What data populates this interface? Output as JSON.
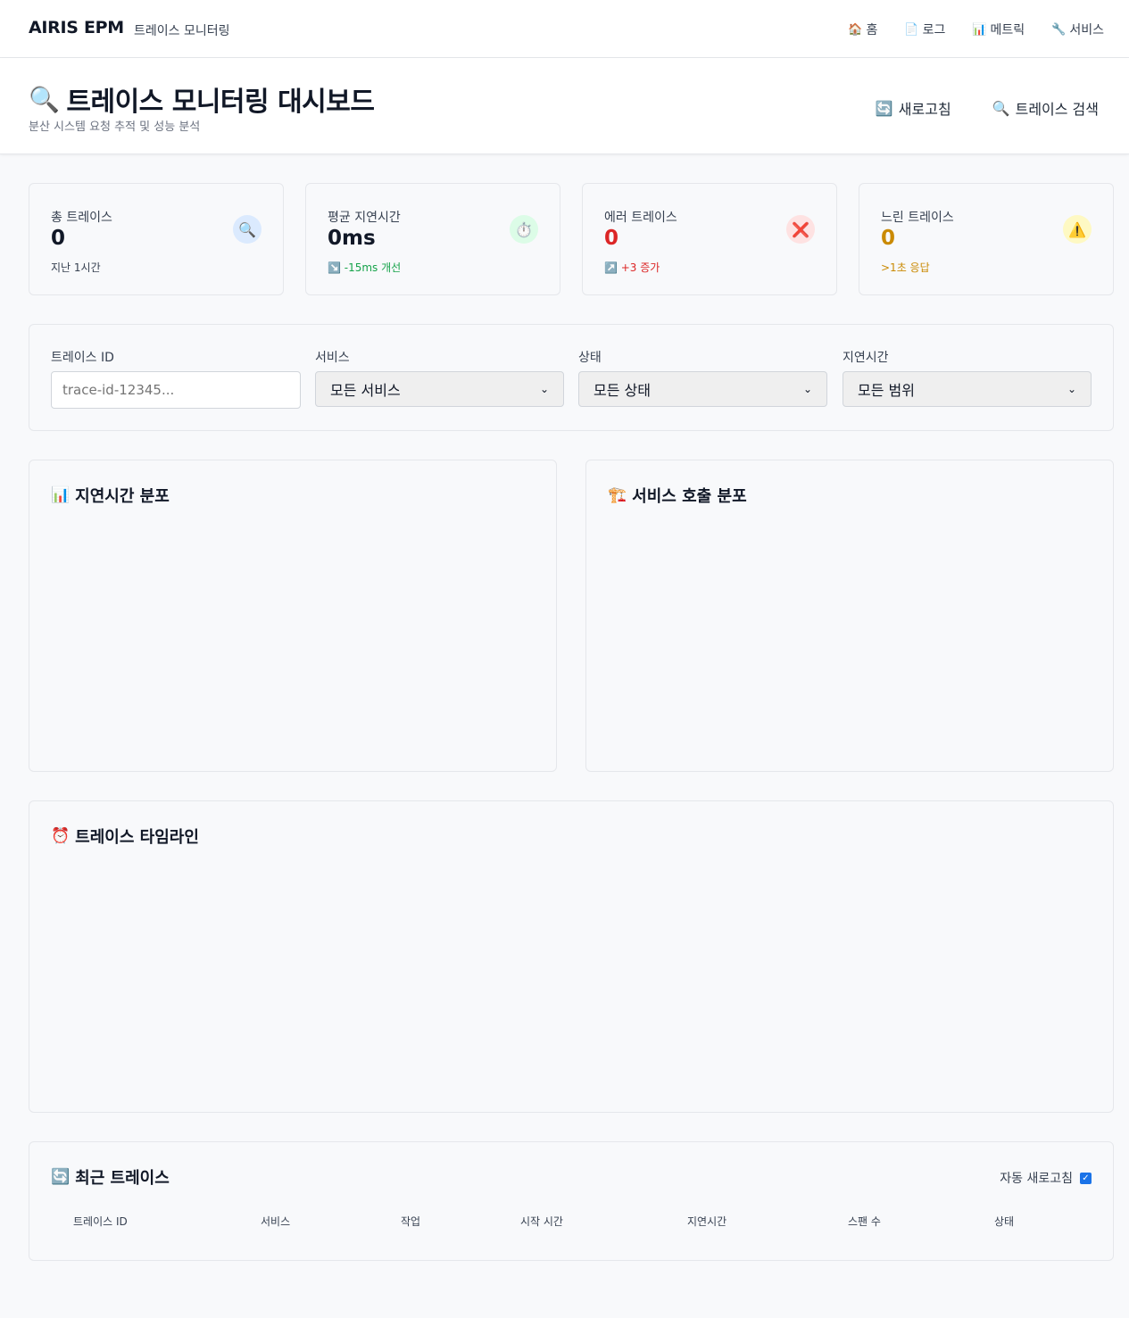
{
  "nav": {
    "brand": "AIRIS EPM",
    "subtitle": "트레이스 모니터링",
    "links": [
      {
        "icon": "🏠",
        "icon_name": "home-icon",
        "label": "홈"
      },
      {
        "icon": "📄",
        "icon_name": "document-icon",
        "label": "로그"
      },
      {
        "icon": "📊",
        "icon_name": "bar-chart-icon",
        "label": "메트릭"
      },
      {
        "icon": "🔧",
        "icon_name": "wrench-icon",
        "label": "서비스"
      }
    ]
  },
  "header": {
    "icon": "🔍",
    "title": "트레이스 모니터링 대시보드",
    "subtitle": "분산 시스템 요청 추적 및 성능 분석",
    "refresh_icon": "🔄",
    "refresh_label": "새로고침",
    "search_icon": "🔍",
    "search_label": "트레이스 검색"
  },
  "stats": [
    {
      "label": "총 트레이스",
      "value": "0",
      "note": "지난 1시간",
      "icon": "🔍",
      "icon_name": "search-icon",
      "value_color": "#111827",
      "note_color": "#374151",
      "icon_bg": "#dbeafe"
    },
    {
      "label": "평균 지연시간",
      "value": "0ms",
      "note": "↘️ -15ms 개선",
      "icon": "⏱️",
      "icon_name": "stopwatch-icon",
      "value_color": "#111827",
      "note_color": "#16a34a",
      "icon_bg": "#dcfce7"
    },
    {
      "label": "에러 트레이스",
      "value": "0",
      "note": "↗️ +3 증가",
      "icon": "❌",
      "icon_name": "error-icon",
      "value_color": "#dc2626",
      "note_color": "#dc2626",
      "icon_bg": "#fee2e2"
    },
    {
      "label": "느린 트레이스",
      "value": "0",
      "note": ">1초 응답",
      "icon": "⚠️",
      "icon_name": "warning-icon",
      "value_color": "#ca8a04",
      "note_color": "#ca8a04",
      "icon_bg": "#fef9c3"
    }
  ],
  "filters": {
    "trace_id_label": "트레이스 ID",
    "trace_id_placeholder": "trace-id-12345...",
    "service_label": "서비스",
    "service_value": "모든 서비스",
    "status_label": "상태",
    "status_value": "모든 상태",
    "latency_label": "지연시간",
    "latency_value": "모든 범위"
  },
  "panels": {
    "latency_dist": {
      "icon": "📊",
      "title": "지연시간 분포"
    },
    "service_calls": {
      "icon": "🏗️",
      "title": "서비스 호출 분포"
    },
    "timeline": {
      "icon": "⏰",
      "title": "트레이스 타임라인"
    }
  },
  "recent": {
    "icon": "🔄",
    "title": "최근 트레이스",
    "auto_refresh_label": "자동 새로고침",
    "auto_refresh_checked": true,
    "columns": [
      "트레이스 ID",
      "서비스",
      "작업",
      "시작 시간",
      "지연시간",
      "스팬 수",
      "상태"
    ]
  }
}
